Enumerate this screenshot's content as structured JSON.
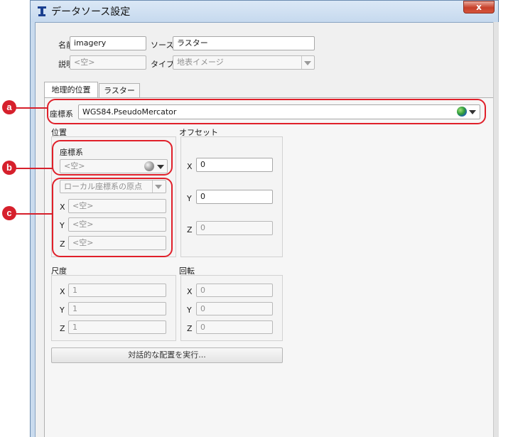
{
  "window": {
    "title": "データソース設定",
    "close_label": "x"
  },
  "top_fields": {
    "name_label": "名前",
    "name_value": "imagery",
    "source_label": "ソース",
    "source_value": "ラスター",
    "desc_label": "説明",
    "desc_value": "<空>",
    "type_label": "タイプ",
    "type_value": "地表イメージ"
  },
  "tabs": [
    {
      "label": "地理的位置"
    },
    {
      "label": "ラスター"
    }
  ],
  "crs": {
    "label": "座標系",
    "value": "WGS84.PseudoMercator"
  },
  "position": {
    "title": "位置",
    "crs_label": "座標系",
    "crs_value": "<空>",
    "origin_value": "ローカル座標系の原点",
    "x_label": "X",
    "x_value": "<空>",
    "y_label": "Y",
    "y_value": "<空>",
    "z_label": "Z",
    "z_value": "<空>"
  },
  "offset": {
    "title": "オフセット",
    "x_label": "X",
    "x_value": "0",
    "y_label": "Y",
    "y_value": "0",
    "z_label": "Z",
    "z_value": "0"
  },
  "scale": {
    "title": "尺度",
    "x_label": "X",
    "x_value": "1",
    "y_label": "Y",
    "y_value": "1",
    "z_label": "Z",
    "z_value": "1"
  },
  "rotation": {
    "title": "回転",
    "x_label": "X",
    "x_value": "0",
    "y_label": "Y",
    "y_value": "0",
    "z_label": "Z",
    "z_value": "0"
  },
  "interactive_button": {
    "label": "対話的な配置を実行..."
  },
  "callouts": {
    "a": "a",
    "b": "b",
    "c": "c"
  },
  "colors": {
    "callout": "#e0202a",
    "badge": "#d6202c"
  },
  "icons": {
    "app": "app-icon",
    "globe": "globe-icon",
    "sphere": "gray-sphere-icon",
    "dropdown": "dropdown-arrow-icon"
  }
}
